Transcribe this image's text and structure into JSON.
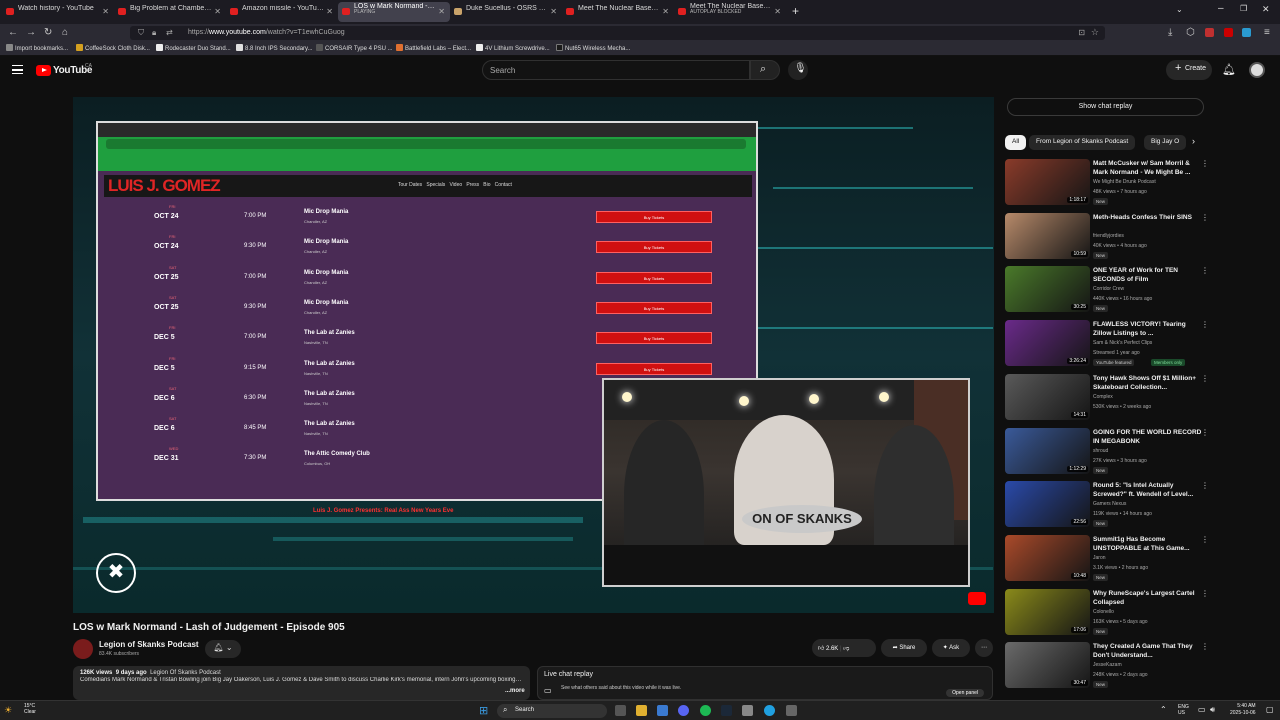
{
  "tabs": [
    {
      "label": "Watch history - YouTube",
      "active": false
    },
    {
      "label": "Big Problem at Chambers - YouTube",
      "active": false
    },
    {
      "label": "Amazon missile - YouTube",
      "active": false
    },
    {
      "label": "LOS w Mark Normand - Lash of Judgement",
      "sub": "PLAYING",
      "active": true
    },
    {
      "label": "Duke Sucellus - OSRS Wiki",
      "active": false
    },
    {
      "label": "Meet The Nuclear Base Employ",
      "active": false
    },
    {
      "label": "Meet The Nuclear Base Employ",
      "sub": "AUTOPLAY BLOCKED",
      "active": false
    }
  ],
  "nav": {
    "url_prefix": "https://",
    "url_domain": "www.youtube.com",
    "url_path": "/watch?v=T1ewhCuGuog"
  },
  "bookmarks": [
    "Import bookmarks...",
    "CoffeeSock Cloth Disk...",
    "Rodecaster Duo Stand...",
    "8.8 Inch IPS Secondary...",
    "CORSAIR Type 4 PSU ...",
    "Battlefield Labs – Elect...",
    "4V Lithium Screwdrive...",
    "Nut65 Wireless Mecha..."
  ],
  "header": {
    "logo_text": "YouTube",
    "country": "CA",
    "search_placeholder": "Search",
    "create_label": "Create"
  },
  "player": {
    "tour_site": {
      "logo": "LUIS J. GOMEZ",
      "nav_items": [
        "Tour Dates",
        "Specials",
        "Video",
        "Press",
        "Bio",
        "Contact"
      ],
      "rows": [
        {
          "day": "FRI",
          "date": "OCT 24",
          "time": "7:00 PM",
          "venue": "Mic Drop Mania",
          "city": "Chandler, AZ",
          "button": "Buy Tickets"
        },
        {
          "day": "FRI",
          "date": "OCT 24",
          "time": "9:30 PM",
          "venue": "Mic Drop Mania",
          "city": "Chandler, AZ",
          "button": "Buy Tickets"
        },
        {
          "day": "SAT",
          "date": "OCT 25",
          "time": "7:00 PM",
          "venue": "Mic Drop Mania",
          "city": "Chandler, AZ",
          "button": "Buy Tickets"
        },
        {
          "day": "SAT",
          "date": "OCT 25",
          "time": "9:30 PM",
          "venue": "Mic Drop Mania",
          "city": "Chandler, AZ",
          "button": "Buy Tickets"
        },
        {
          "day": "FRI",
          "date": "DEC 5",
          "time": "7:00 PM",
          "venue": "The Lab at Zanies",
          "city": "Nashville, TN",
          "button": "Buy Tickets"
        },
        {
          "day": "FRI",
          "date": "DEC 5",
          "time": "9:15 PM",
          "venue": "The Lab at Zanies",
          "city": "Nashville, TN",
          "button": "Buy Tickets"
        },
        {
          "day": "SAT",
          "date": "DEC 6",
          "time": "6:30 PM",
          "venue": "The Lab at Zanies",
          "city": "Nashville, TN",
          "button": ""
        },
        {
          "day": "SAT",
          "date": "DEC 6",
          "time": "8:45 PM",
          "venue": "The Lab at Zanies",
          "city": "Nashville, TN",
          "button": ""
        },
        {
          "day": "WED",
          "date": "DEC 31",
          "time": "7:30 PM",
          "venue": "The Attic Comedy Club",
          "city": "Columbus, OH",
          "button": ""
        }
      ],
      "footer": "Luis J. Gomez Presents: Real Ass New Years Eve"
    },
    "banner_text": "ON OF SKANKS"
  },
  "video": {
    "title": "LOS w Mark Normand - Lash of Judgement - Episode 905",
    "channel": "Legion of Skanks Podcast",
    "subscribers": "83.4K subscribers",
    "likes": "2.6K",
    "share_label": "Share",
    "ask_label": "Ask",
    "views": "126K views",
    "age": "9 days ago",
    "desc_channel": "Legion Of Skanks Podcast",
    "description": "Comedians Mark Normand & Tristan Bowling join Big Jay Oakerson, Luis J. Gomez & Dave Smith to discuss Charlie Kirk's memorial, intern John's upcoming boxing match against Mike Harrington. Plus, the gang judges round two of the Biggest Loser Shoulders Golden Ticket...",
    "more_label": "...more"
  },
  "live_chat": {
    "title": "Live chat replay",
    "subtitle": "See what others said about this video while it was live.",
    "open_label": "Open panel"
  },
  "sidebar": {
    "chat_replay_label": "Show chat replay",
    "chips": [
      "All",
      "From Legion of Skanks Podcast",
      "Big Jay O"
    ],
    "recommendations": [
      {
        "title": "Matt McCusker w/ Sam Morril & Mark Normand - We Might Be ...",
        "channel": "We Might Be Drunk Podcast",
        "meta": "48K views • 7 hours ago",
        "badge": "New",
        "duration": "1:18:17",
        "thumb_color": "#8a3b2a"
      },
      {
        "title": "Meth-Heads Confess Their SINS",
        "channel": "friendlyjordies",
        "meta": "40K views • 4 hours ago",
        "badge": "New",
        "duration": "10:59",
        "thumb_color": "#b78a6a"
      },
      {
        "title": "ONE YEAR of Work for TEN SECONDS of Film",
        "channel": "Corridor Crew",
        "meta": "440K views • 16 hours ago",
        "badge": "New",
        "duration": "30:25",
        "thumb_color": "#4a7a2a"
      },
      {
        "title": "FLAWLESS VICTORY! Tearing Zillow Listings to ...",
        "channel": "Sam & Nick's Perfect Clips",
        "meta": "Streamed 1 year ago",
        "badge": "YouTube featured",
        "badge2": "Members only",
        "duration": "3:26:24",
        "thumb_color": "#6a2a8a"
      },
      {
        "title": "Tony Hawk Shows Off $1 Million+ Skateboard Collection...",
        "channel": "Complex",
        "meta": "530K views • 2 weeks ago",
        "badge": "",
        "duration": "14:31",
        "thumb_color": "#5a5a5a"
      },
      {
        "title": "GOING FOR THE WORLD RECORD IN MEGABONK",
        "channel": "shroud",
        "meta": "27K views • 3 hours ago",
        "badge": "New",
        "duration": "1:12:29",
        "thumb_color": "#3a5a9a"
      },
      {
        "title": "Round 5: \"Is Intel Actually Screwed?\" ft. Wendell of Level...",
        "channel": "Gamers Nexus",
        "meta": "119K views • 14 hours ago",
        "badge": "New",
        "duration": "22:56",
        "thumb_color": "#2a4aaa"
      },
      {
        "title": "Summit1g Has Become UNSTOPPABLE at This Game...",
        "channel": "Jaron",
        "meta": "3.1K views • 2 hours ago",
        "badge": "New",
        "duration": "10:48",
        "thumb_color": "#aa4a2a"
      },
      {
        "title": "Why RuneScape's Largest Cartel Collapsed",
        "channel": "Colonello",
        "meta": "163K views • 5 days ago",
        "badge": "New",
        "duration": "17:06",
        "thumb_color": "#8a8a1a"
      },
      {
        "title": "They Created A Game That They Don't Understand...",
        "channel": "JesseKazam",
        "meta": "248K views • 2 days ago",
        "badge": "New",
        "duration": "30:47",
        "thumb_color": "#6a6a6a"
      }
    ]
  },
  "taskbar": {
    "temp": "15°C",
    "weather": "Clear",
    "search_label": "Search",
    "lang": "ENG",
    "region": "US",
    "time": "5:40 AM",
    "date": "2025-10-06"
  }
}
